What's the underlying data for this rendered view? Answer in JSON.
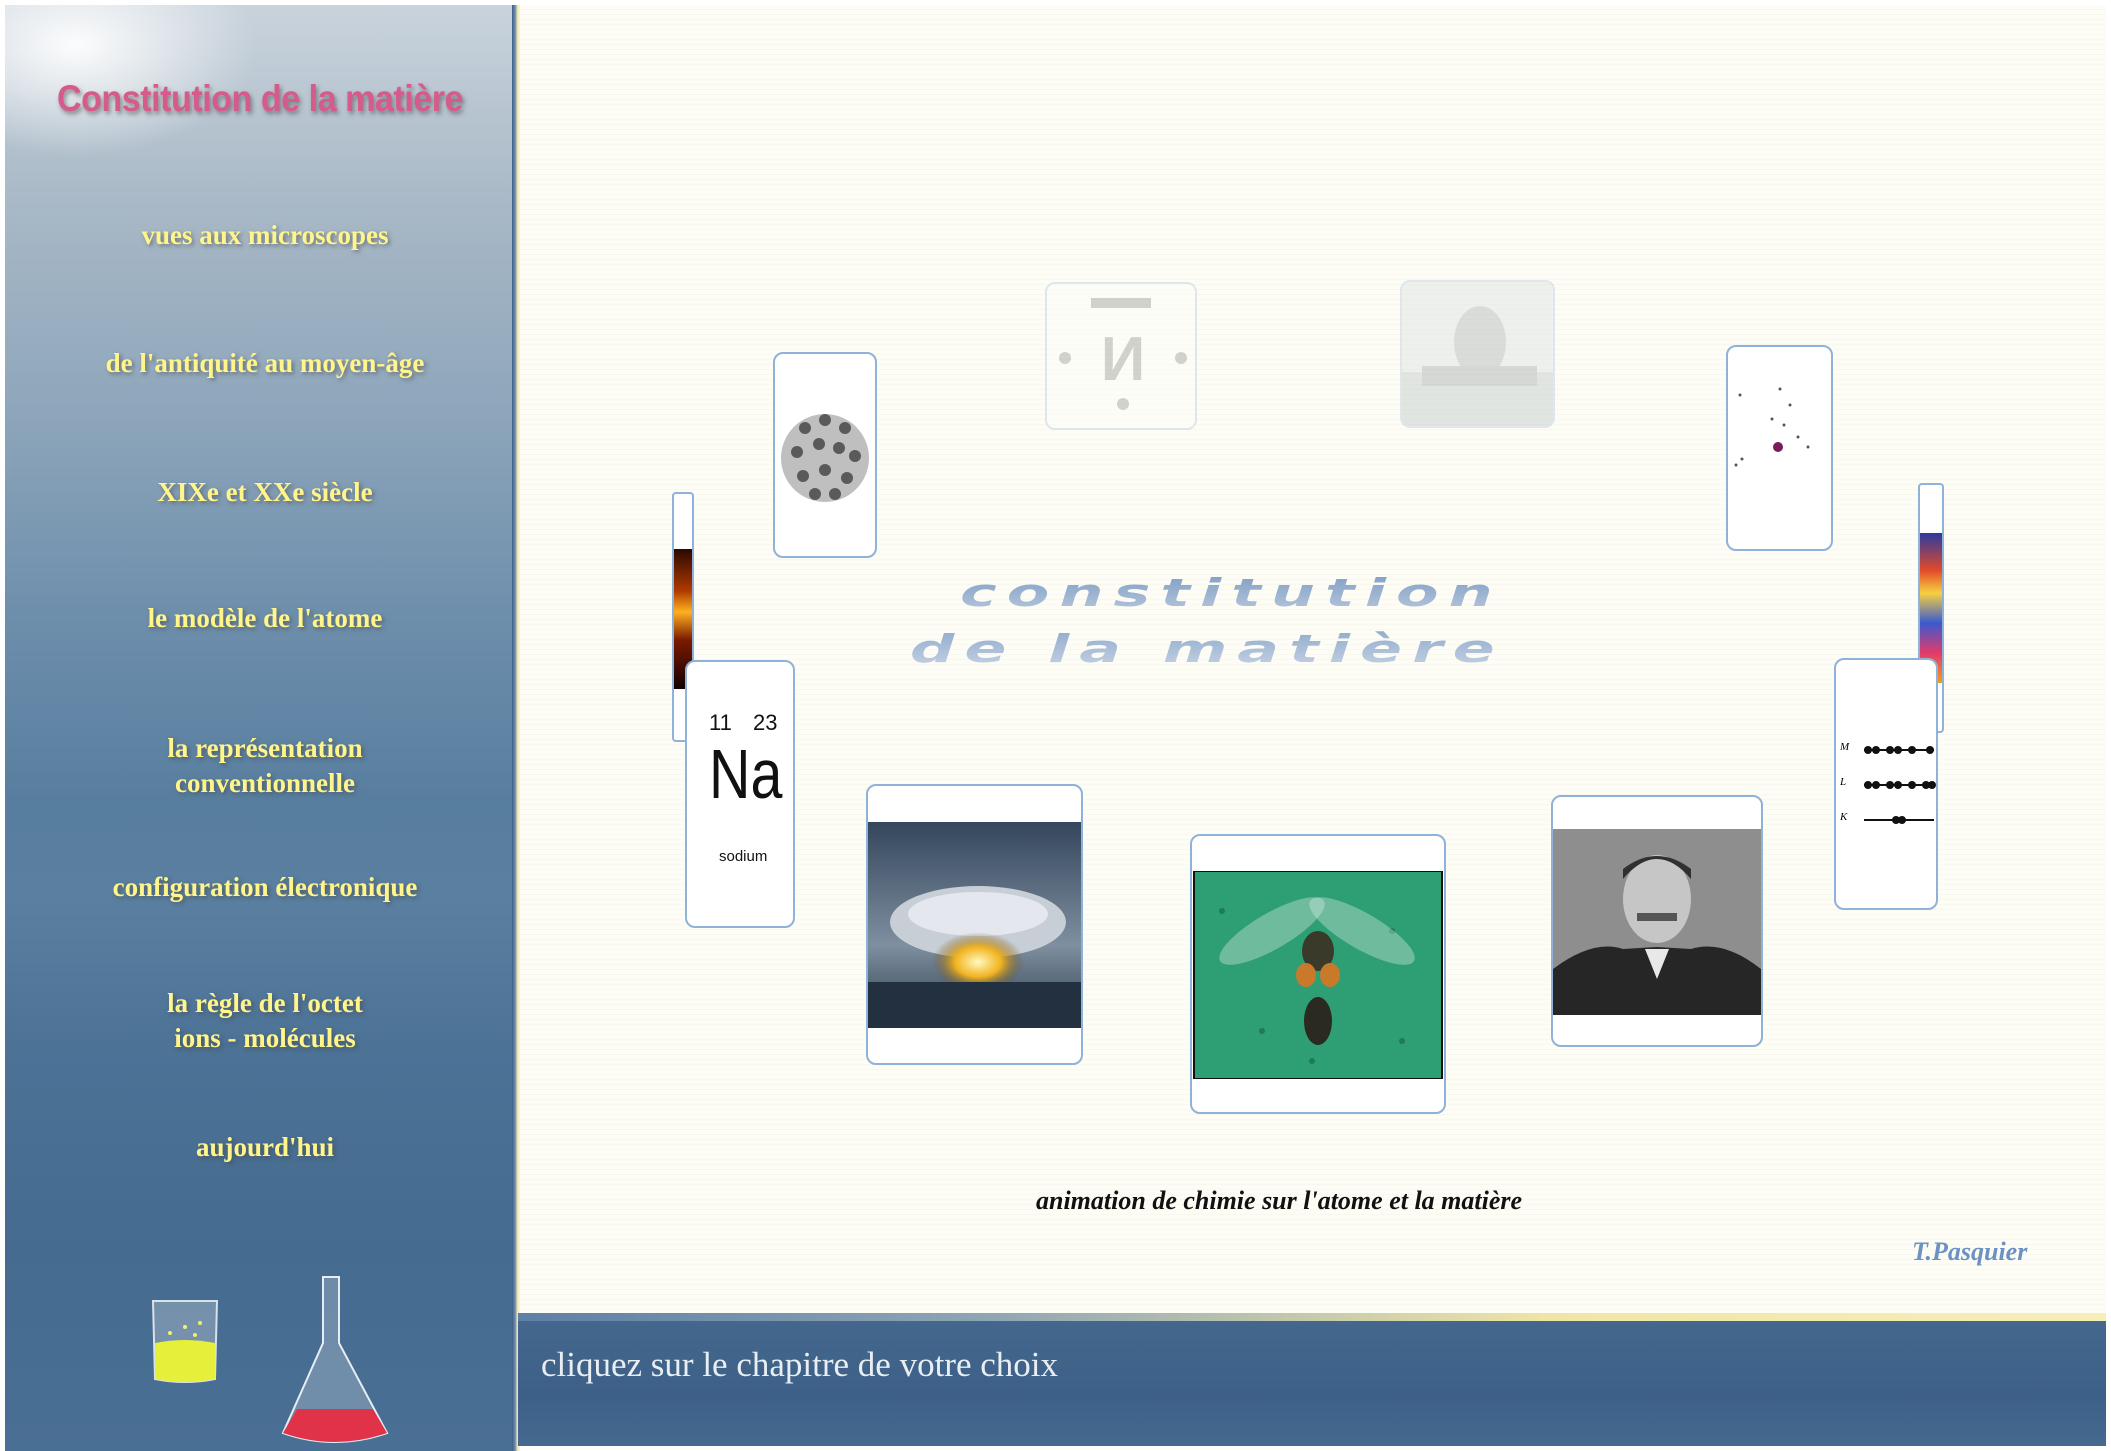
{
  "sidebar": {
    "title": "Constitution de la matière",
    "items": [
      {
        "label": "vues aux microscopes"
      },
      {
        "label": "de l'antiquité au moyen-âge"
      },
      {
        "label": "XIXe et XXe siècle"
      },
      {
        "label": "le modèle de l'atome"
      },
      {
        "label": "la représentation conventionnelle"
      },
      {
        "label": "configuration électronique"
      },
      {
        "label": "la règle de l'octet ions - molécules"
      },
      {
        "label": "aujourd'hui"
      }
    ]
  },
  "main": {
    "title_line1": "constitution",
    "title_line2": "de la matière",
    "tagline": "animation de chimie sur l'atome et la matière",
    "author": "T.Pasquier",
    "element_card": {
      "atomic_number": "11",
      "mass_number": "23",
      "symbol": "Na",
      "name": "sodium"
    },
    "shell_card": {
      "shells": [
        "M",
        "L",
        "K"
      ]
    }
  },
  "footer": {
    "instruction": "cliquez sur le chapitre de votre choix"
  }
}
